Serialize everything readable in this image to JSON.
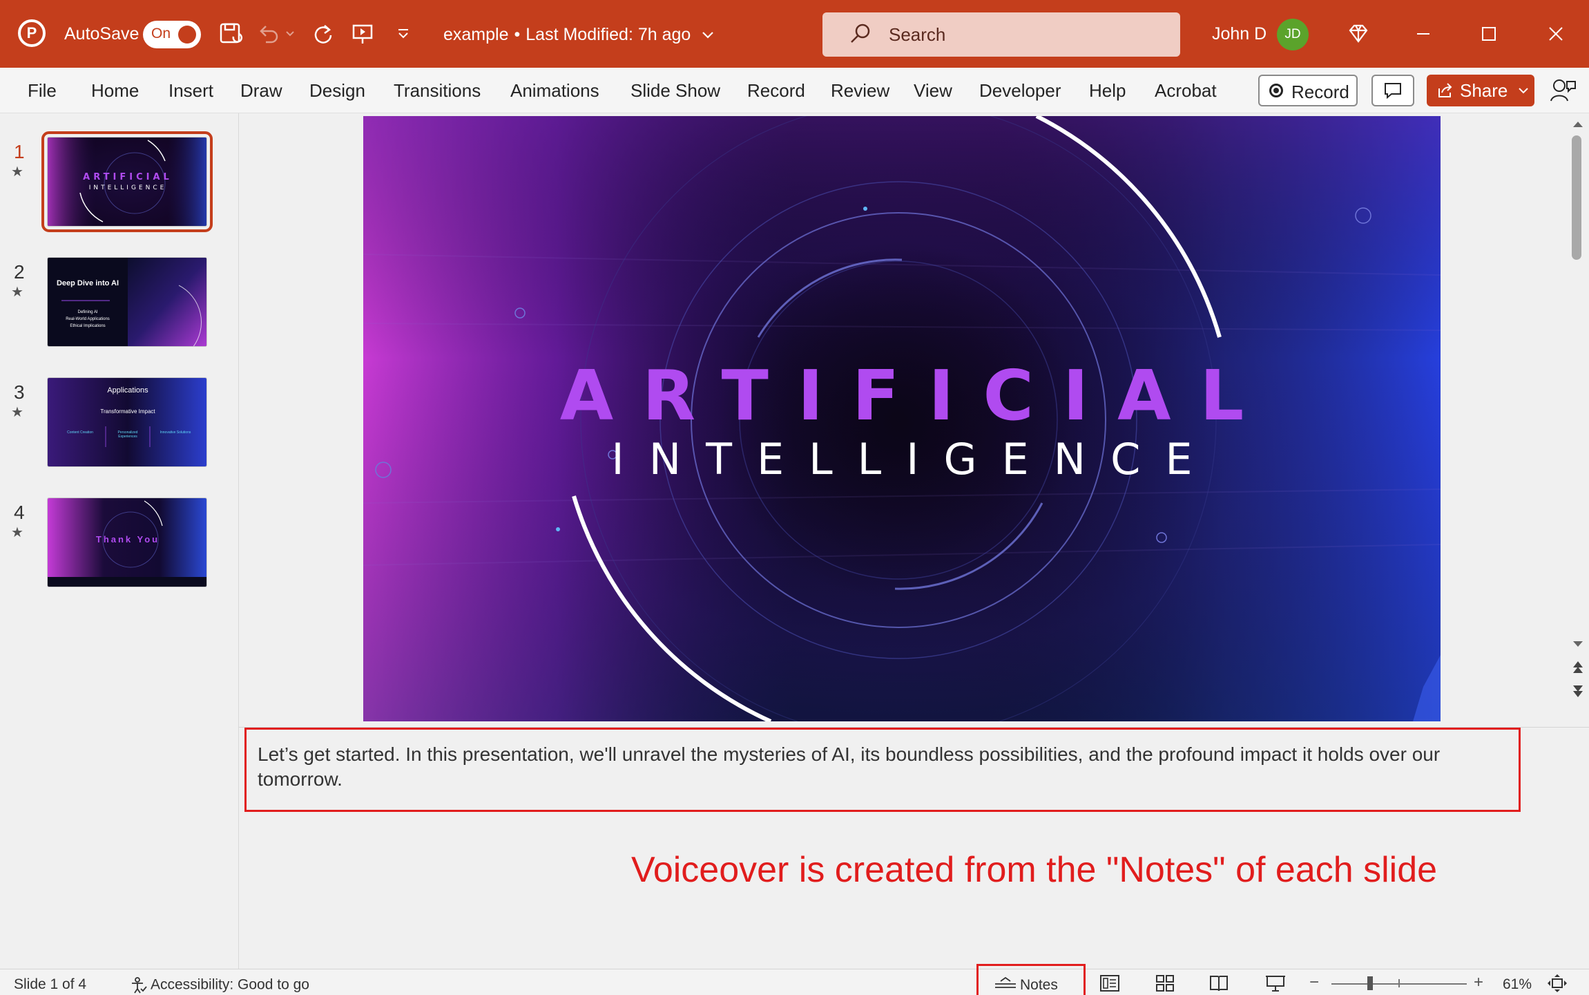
{
  "titlebar": {
    "autosave_label": "AutoSave",
    "autosave_state": "On",
    "doc_name": "example",
    "separator": "•",
    "last_modified": "Last Modified: 7h ago",
    "search_placeholder": "Search",
    "user_name": "John D",
    "user_initials": "JD",
    "accent_color": "#c43e1c"
  },
  "ribbon": {
    "tabs": [
      "File",
      "Home",
      "Insert",
      "Draw",
      "Design",
      "Transitions",
      "Animations",
      "Slide Show",
      "Record",
      "Review",
      "View",
      "Developer",
      "Help",
      "Acrobat"
    ],
    "record_label": "Record",
    "share_label": "Share"
  },
  "thumbnails": [
    {
      "num": "1",
      "title": "ARTIFICIAL",
      "subtitle": "INTELLIGENCE"
    },
    {
      "num": "2",
      "title": "Deep Dive into AI",
      "lines": [
        "Defining AI",
        "Real-World Applications",
        "Ethical Implications"
      ]
    },
    {
      "num": "3",
      "title": "Applications",
      "subtitle": "Transformative Impact",
      "cols": [
        "Content Creation",
        "Personalized Experiences",
        "Innovative Solutions"
      ]
    },
    {
      "num": "4",
      "title": "Thank You"
    }
  ],
  "slide": {
    "title": "ARTIFICIAL",
    "subtitle": "INTELLIGENCE"
  },
  "notes": {
    "text": "Let’s get started. In this presentation, we'll unravel the mysteries of AI, its boundless possibilities, and the profound impact it holds over our tomorrow."
  },
  "annotation": "Voiceover is created from the \"Notes\" of each slide",
  "statusbar": {
    "slide_counter": "Slide 1 of 4",
    "accessibility": "Accessibility: Good to go",
    "notes_label": "Notes",
    "zoom_minus": "−",
    "zoom_plus": "+",
    "zoom": "61%"
  }
}
